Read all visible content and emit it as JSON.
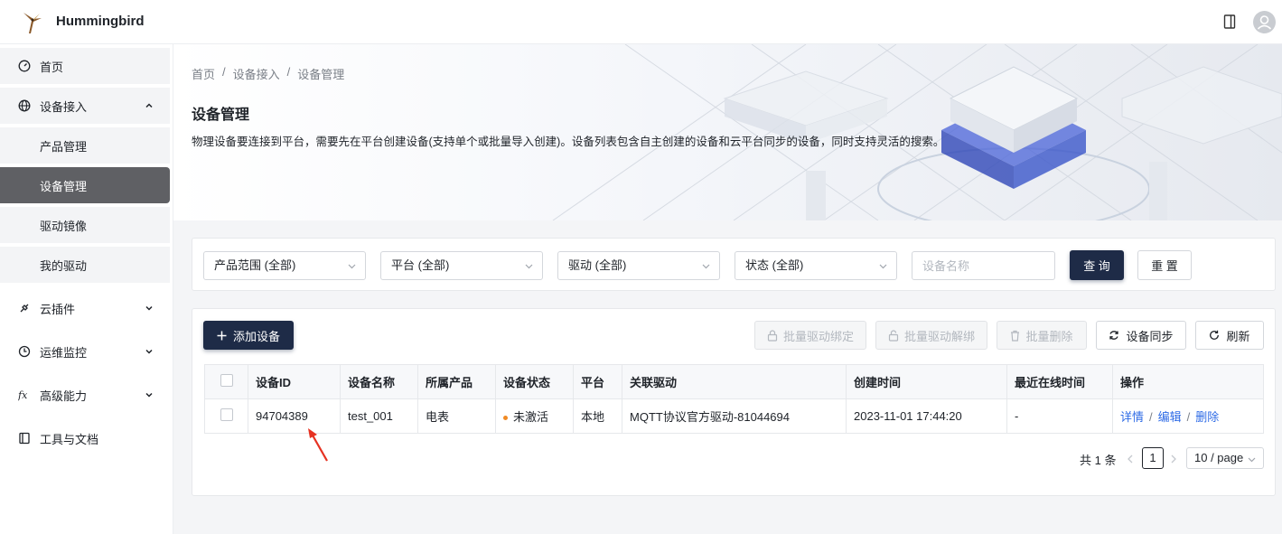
{
  "header": {
    "app_title": "Hummingbird"
  },
  "sidebar": {
    "items": [
      {
        "label": "首页",
        "icon": "dashboard-icon"
      },
      {
        "label": "设备接入",
        "icon": "globe-icon"
      },
      {
        "label": "产品管理"
      },
      {
        "label": "设备管理"
      },
      {
        "label": "驱动镜像"
      },
      {
        "label": "我的驱动"
      },
      {
        "label": "云插件",
        "icon": "plugin-icon"
      },
      {
        "label": "运维监控",
        "icon": "monitor-icon"
      },
      {
        "label": "高级能力",
        "icon": "fx-icon"
      },
      {
        "label": "工具与文档",
        "icon": "book-icon"
      }
    ]
  },
  "banner": {
    "breadcrumb": [
      "首页",
      "/",
      "设备接入",
      "/",
      "设备管理"
    ],
    "title": "设备管理",
    "description": "物理设备要连接到平台，需要先在平台创建设备(支持单个或批量导入创建)。设备列表包含自主创建的设备和云平台同步的设备，同时支持灵活的搜索。"
  },
  "filters": {
    "product": "产品范围 (全部)",
    "platform": "平台 (全部)",
    "driver": "驱动 (全部)",
    "status": "状态 (全部)",
    "name_placeholder": "设备名称",
    "query_label": "查 询",
    "reset_label": "重 置"
  },
  "toolbar": {
    "add_label": "添加设备",
    "bind_label": "批量驱动绑定",
    "unbind_label": "批量驱动解绑",
    "delete_label": "批量删除",
    "sync_label": "设备同步",
    "refresh_label": "刷新"
  },
  "table": {
    "columns": [
      "设备ID",
      "设备名称",
      "所属产品",
      "设备状态",
      "平台",
      "关联驱动",
      "创建时间",
      "最近在线时间",
      "操作"
    ],
    "rows": [
      {
        "id": "94704389",
        "name": "test_001",
        "product": "电表",
        "status": "未激活",
        "platform": "本地",
        "driver": "MQTT协议官方驱动-81044694",
        "created": "2023-11-01 17:44:20",
        "last_online": "-",
        "actions": [
          "详情",
          "编辑",
          "删除"
        ]
      }
    ],
    "status_color": "#f08a24"
  },
  "pagination": {
    "total": "共 1 条",
    "current_page": "1",
    "page_size": "10 / page"
  }
}
